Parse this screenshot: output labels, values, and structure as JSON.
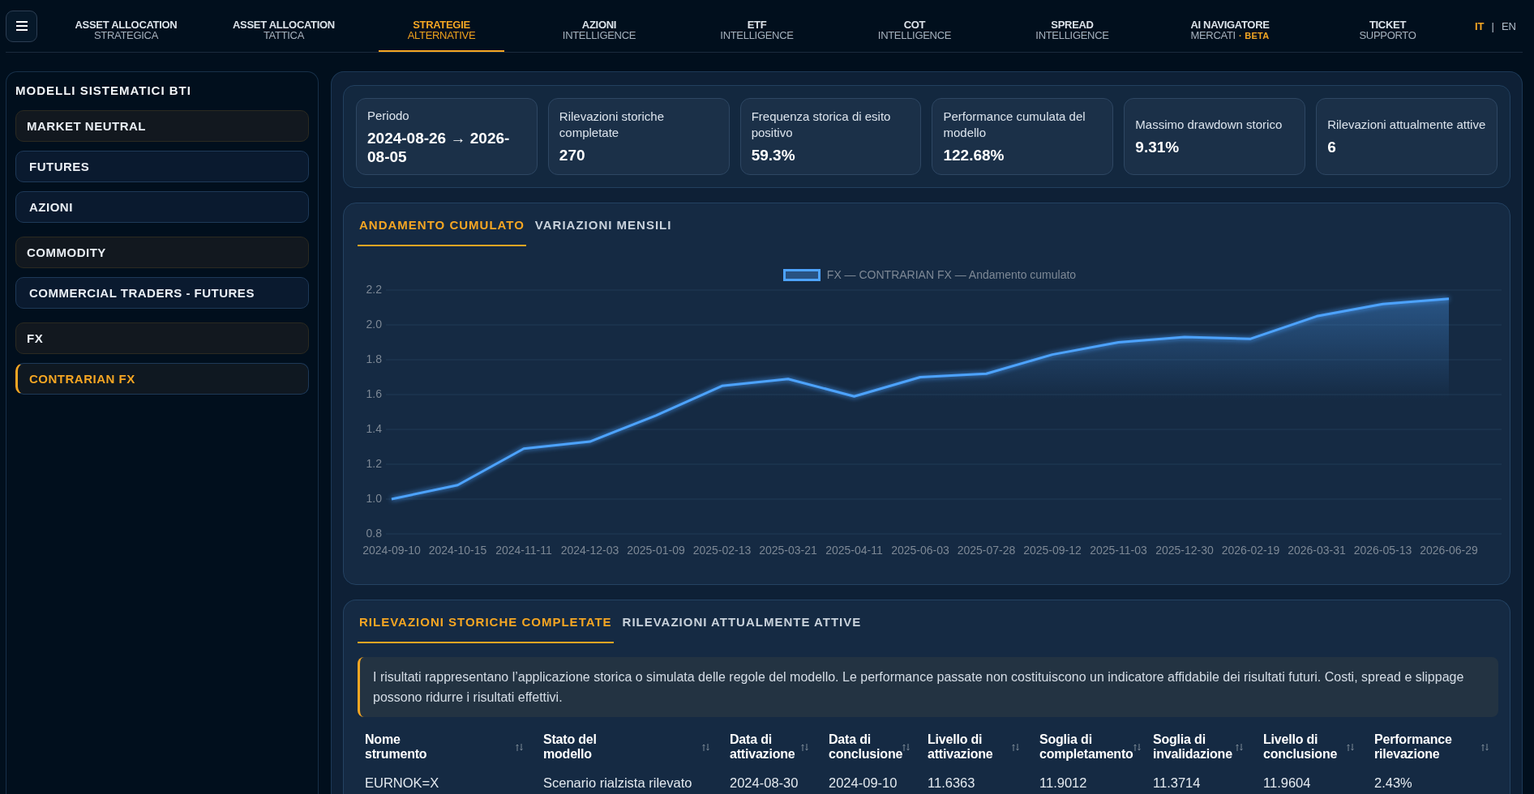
{
  "header": {
    "nav": [
      {
        "title": "ASSET ALLOCATION",
        "subtitle": "STRATEGICA",
        "selected": false
      },
      {
        "title": "ASSET ALLOCATION",
        "subtitle": "TATTICA",
        "selected": false
      },
      {
        "title": "STRATEGIE",
        "subtitle": "ALTERNATIVE",
        "selected": true
      },
      {
        "title": "AZIONI",
        "subtitle": "INTELLIGENCE",
        "selected": false
      },
      {
        "title": "ETF",
        "subtitle": "INTELLIGENCE",
        "selected": false
      },
      {
        "title": "COT",
        "subtitle": "INTELLIGENCE",
        "selected": false
      },
      {
        "title": "SPREAD",
        "subtitle": "INTELLIGENCE",
        "selected": false
      },
      {
        "title": "AI NAVIGATORE",
        "subtitle": "MERCATI",
        "badge": "· BETA",
        "selected": false
      },
      {
        "title": "TICKET",
        "subtitle": "SUPPORTO",
        "selected": false
      }
    ],
    "languages": [
      {
        "label": "IT",
        "selected": true
      },
      {
        "label": "EN",
        "selected": false
      }
    ],
    "language_separator": "|"
  },
  "sidebar": {
    "title": "MODELLI SISTEMATICI BTI",
    "items": [
      {
        "label": "MARKET NEUTRAL",
        "selected": false,
        "children": [
          {
            "label": "FUTURES",
            "selected": false
          },
          {
            "label": "AZIONI",
            "selected": false
          }
        ]
      },
      {
        "label": "COMMODITY",
        "selected": false,
        "children": [
          {
            "label": "COMMERCIAL TRADERS - FUTURES",
            "selected": false
          }
        ]
      },
      {
        "label": "FX",
        "selected": false,
        "children": [
          {
            "label": "CONTRARIAN FX",
            "selected": true
          }
        ]
      }
    ]
  },
  "summary": {
    "cards": [
      {
        "label": "Periodo",
        "value": "2024-08-26 → 2026-08-05"
      },
      {
        "label": "Rilevazioni storiche completate",
        "value": "270"
      },
      {
        "label": "Frequenza storica di esito positivo",
        "value": "59.3%"
      },
      {
        "label": "Performance cumulata del modello",
        "value": "122.68%"
      },
      {
        "label": "Massimo drawdown storico",
        "value": "9.31%"
      },
      {
        "label": "Rilevazioni attualmente attive",
        "value": "6"
      }
    ]
  },
  "performance_chart": {
    "tabs": [
      {
        "label": "ANDAMENTO CUMULATO",
        "selected": true
      },
      {
        "label": "VARIAZIONI MENSILI",
        "selected": false
      }
    ],
    "chart_data": {
      "type": "area",
      "categories": [
        "2024-09-10",
        "2024-10-15",
        "2024-11-11",
        "2024-12-03",
        "2025-01-09",
        "2025-02-13",
        "2025-03-21",
        "2025-04-11",
        "2025-06-03",
        "2025-07-28",
        "2025-09-12",
        "2025-11-03",
        "2025-12-30",
        "2026-02-19",
        "2026-03-31",
        "2026-05-13",
        "2026-06-29"
      ],
      "series": [
        {
          "name": "FX — CONTRARIAN FX — Andamento cumulato",
          "color": "#4da3ff",
          "values": [
            1.0,
            1.08,
            1.29,
            1.33,
            1.48,
            1.65,
            1.69,
            1.59,
            1.7,
            1.72,
            1.83,
            1.9,
            1.93,
            1.92,
            2.05,
            2.12,
            2.15
          ]
        }
      ],
      "ylim": [
        0.8,
        2.2
      ],
      "yticks": [
        {
          "value": 0.8,
          "label": "0.8"
        },
        {
          "value": 1.0,
          "label": "1.0"
        },
        {
          "value": 1.2,
          "label": "1.2"
        },
        {
          "value": 1.4,
          "label": "1.4"
        },
        {
          "value": 1.6,
          "label": "1.6"
        },
        {
          "value": 1.8,
          "label": "1.8"
        },
        {
          "value": 2.0,
          "label": "2.0"
        },
        {
          "value": 2.2,
          "label": "2.2"
        }
      ],
      "grid": true
    }
  },
  "results": {
    "tabs": [
      {
        "label": "RILEVAZIONI STORICHE COMPLETATE",
        "selected": true
      },
      {
        "label": "RILEVAZIONI ATTUALMENTE ATTIVE",
        "selected": false
      }
    ],
    "notice": "I risultati rappresentano l’applicazione storica o simulata delle regole del modello. Le performance passate non costituiscono un indicatore affidabile dei risultati futuri. Costi, spread e slippage possono ridurre i risultati effettivi.",
    "table": {
      "columns": [
        {
          "label_lines": [
            "Nome",
            "strumento"
          ]
        },
        {
          "label_lines": [
            "Stato del",
            "modello"
          ]
        },
        {
          "label_lines": [
            "Data di",
            "attivazione"
          ]
        },
        {
          "label_lines": [
            "Data di",
            "conclusione"
          ]
        },
        {
          "label_lines": [
            "Livello di",
            "attivazione"
          ]
        },
        {
          "label_lines": [
            "Soglia di",
            "completamento"
          ]
        },
        {
          "label_lines": [
            "Soglia di",
            "invalidazione"
          ]
        },
        {
          "label_lines": [
            "Livello di",
            "conclusione"
          ]
        },
        {
          "label_lines": [
            "Performance",
            "rilevazione"
          ]
        }
      ],
      "rows": [
        [
          "EURNOK=X",
          "Scenario rialzista rilevato",
          "2024-08-30",
          "2024-09-10",
          "11.6363",
          "11.9012",
          "11.3714",
          "11.9604",
          "2.43%"
        ]
      ]
    }
  }
}
